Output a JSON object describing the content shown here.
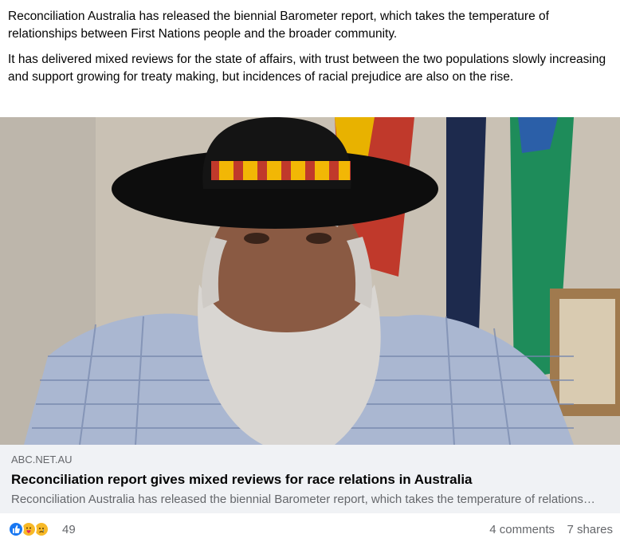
{
  "post": {
    "paragraphs": [
      "Reconciliation Australia has released the biennial Barometer report, which takes the temperature of relationships between First Nations people and the broader community.",
      "It has delivered mixed reviews for the state of affairs, with trust between the two populations slowly increasing and support growing for treaty making, but incidences of racial prejudice are also on the rise."
    ]
  },
  "link": {
    "domain": "ABC.NET.AU",
    "headline": "Reconciliation report gives mixed reviews for race relations in Australia",
    "description": "Reconciliation Australia has released the biennial Barometer report, which takes the temperature of relationships between First Nations people and the broader community."
  },
  "reactions": {
    "icons": [
      "like-icon",
      "care-icon",
      "sad-icon"
    ],
    "count": "49",
    "comments": "4 comments",
    "shares": "7 shares"
  },
  "colors": {
    "like": "#1877f2",
    "care": "#f7b928",
    "sad": "#f7b928",
    "preview_bg": "#f0f2f5",
    "muted_text": "#65676b"
  }
}
